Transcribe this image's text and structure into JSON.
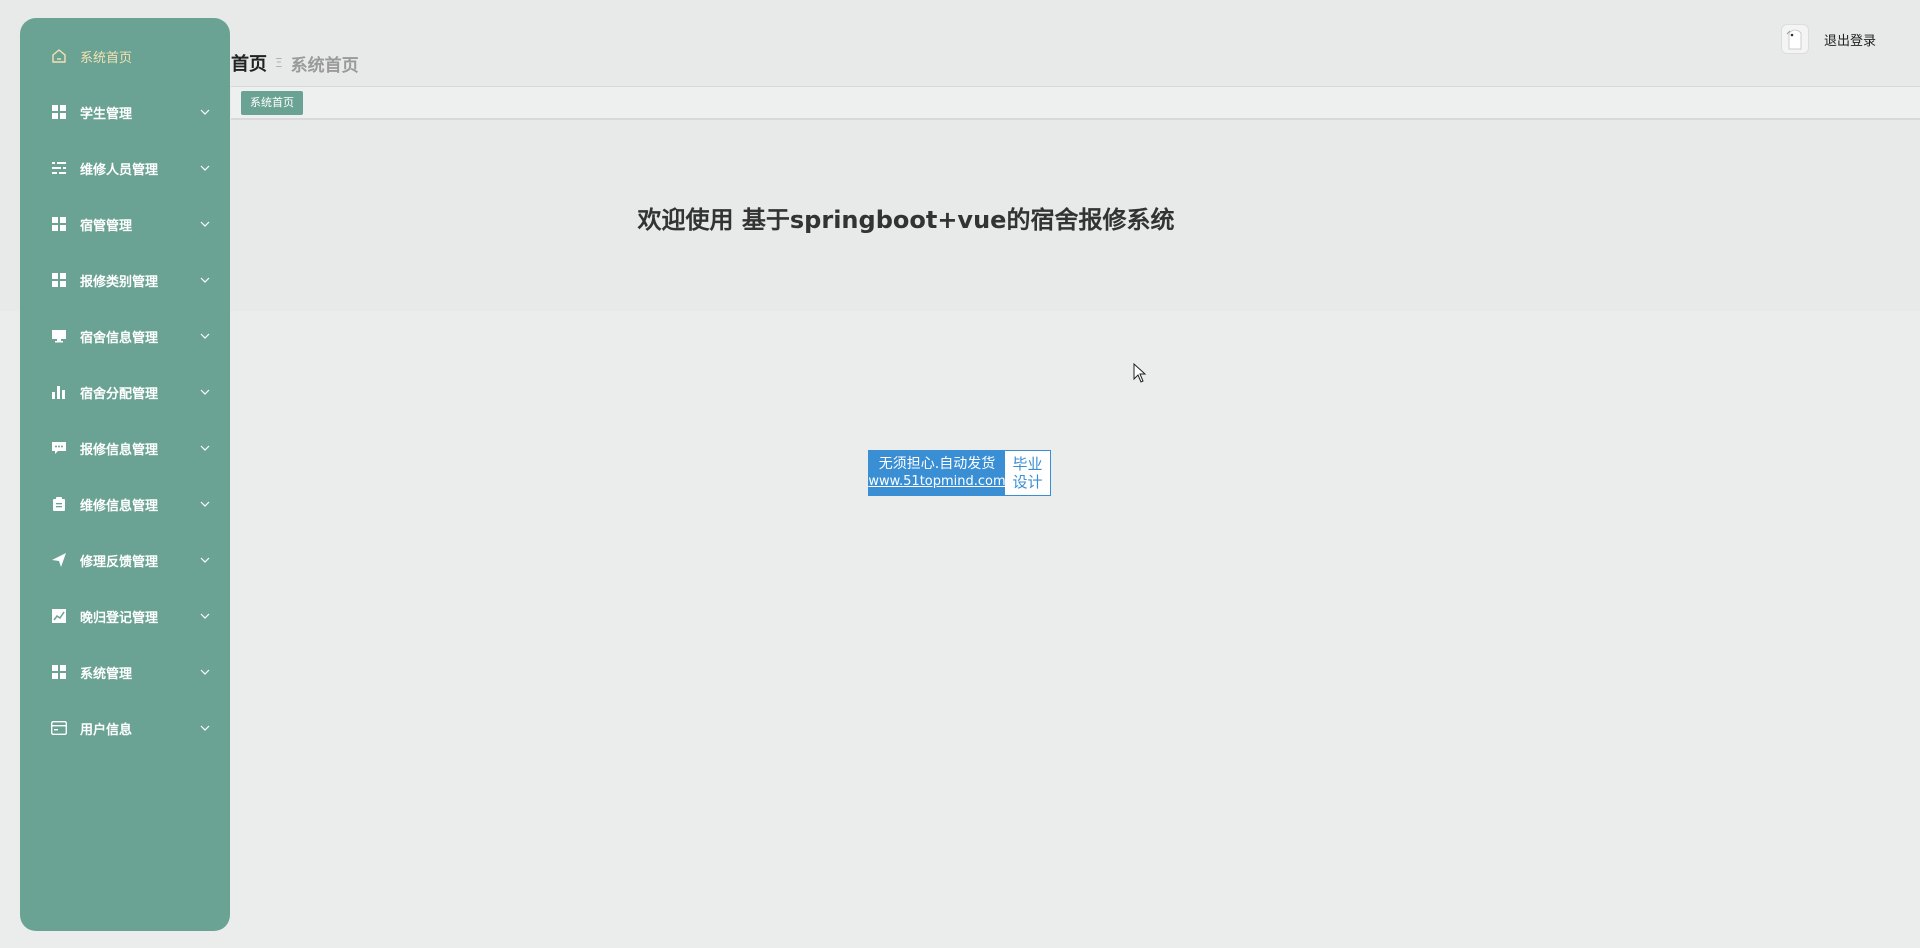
{
  "header": {
    "breadcrumb_first": "首页",
    "breadcrumb_sep": "Ξ",
    "breadcrumb_current": "系统首页",
    "logout_label": "退出登录"
  },
  "tags": {
    "active": "系统首页"
  },
  "sidebar": {
    "items": [
      {
        "label": "系统首页",
        "icon": "home-icon"
      },
      {
        "label": "学生管理",
        "icon": "grid-icon"
      },
      {
        "label": "维修人员管理",
        "icon": "list-icon"
      },
      {
        "label": "宿管管理",
        "icon": "grid-icon"
      },
      {
        "label": "报修类别管理",
        "icon": "grid-icon"
      },
      {
        "label": "宿舍信息管理",
        "icon": "monitor-icon"
      },
      {
        "label": "宿舍分配管理",
        "icon": "bar-chart-icon"
      },
      {
        "label": "报修信息管理",
        "icon": "chat-icon"
      },
      {
        "label": "维修信息管理",
        "icon": "clipboard-icon"
      },
      {
        "label": "修理反馈管理",
        "icon": "send-icon"
      },
      {
        "label": "晚归登记管理",
        "icon": "line-chart-icon"
      },
      {
        "label": "系统管理",
        "icon": "grid-icon"
      },
      {
        "label": "用户信息",
        "icon": "card-icon"
      }
    ]
  },
  "main": {
    "welcome": "欢迎使用 基于springboot+vue的宿舍报修系统"
  },
  "badge": {
    "line1": "无须担心.自动发货",
    "line2": "www.51topmind.com",
    "right1": "毕业",
    "right2": "设计"
  },
  "colors": {
    "sidebar_bg": "#6aa393",
    "active_label": "#f3e2b4",
    "page_bg": "#ebecec",
    "badge_blue": "#3a8fd4"
  }
}
